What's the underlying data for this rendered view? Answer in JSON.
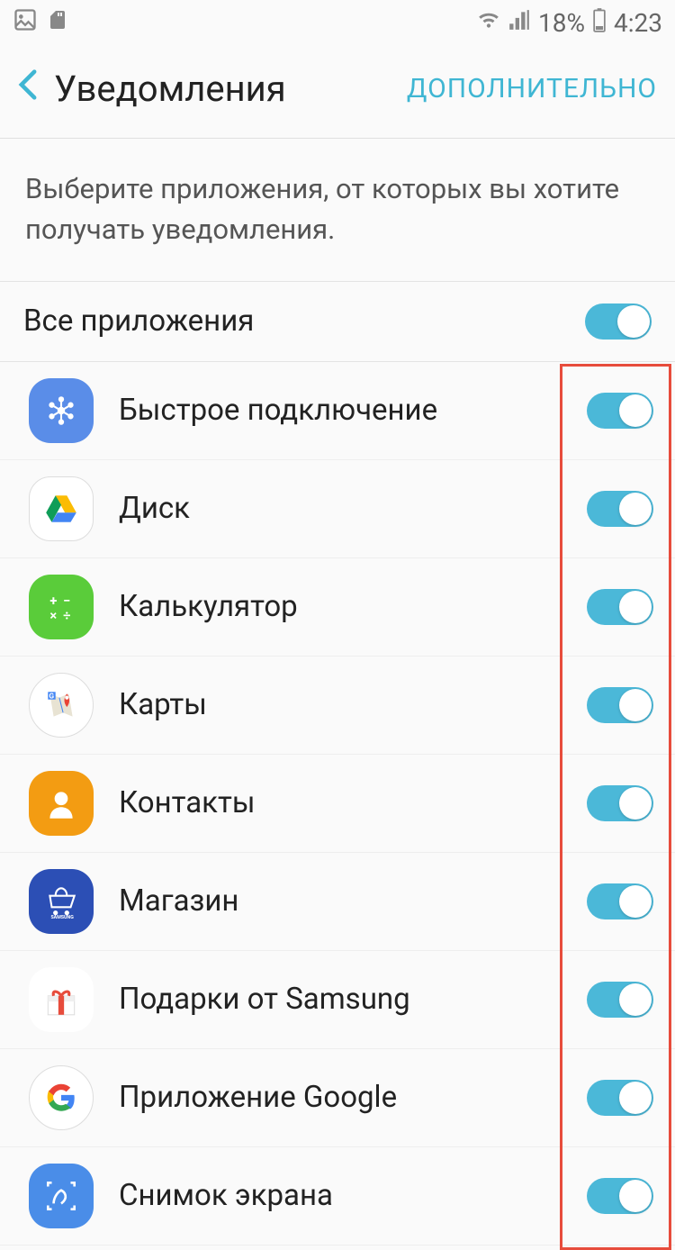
{
  "status": {
    "battery": "18%",
    "time": "4:23"
  },
  "header": {
    "title": "Уведомления",
    "advanced": "ДОПОЛНИТЕЛЬНО"
  },
  "instruction": "Выберите приложения, от которых вы хотите получать уведомления.",
  "all_apps_label": "Все приложения",
  "apps": [
    {
      "name": "Быстрое подключение",
      "icon": "quick",
      "enabled": true
    },
    {
      "name": "Диск",
      "icon": "drive",
      "enabled": true
    },
    {
      "name": "Калькулятор",
      "icon": "calc",
      "enabled": true
    },
    {
      "name": "Карты",
      "icon": "maps",
      "enabled": true
    },
    {
      "name": "Контакты",
      "icon": "contacts",
      "enabled": true
    },
    {
      "name": "Магазин",
      "icon": "store",
      "enabled": true
    },
    {
      "name": "Подарки от Samsung",
      "icon": "gifts",
      "enabled": true
    },
    {
      "name": "Приложение Google",
      "icon": "google",
      "enabled": true
    },
    {
      "name": "Снимок экрана",
      "icon": "screenshot",
      "enabled": true
    }
  ]
}
